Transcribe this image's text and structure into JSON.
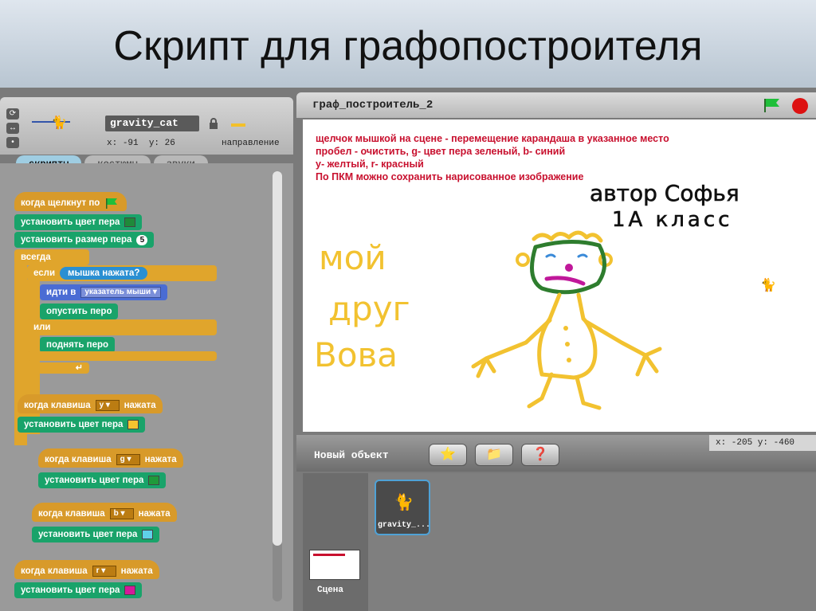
{
  "slide": {
    "title": "Скрипт для графопостроителя"
  },
  "sprite": {
    "name": "gravity_cat",
    "x_label": "x:",
    "x_value": "-91",
    "y_label": "y:",
    "y_value": "26",
    "direction_label": "направление"
  },
  "tabs": [
    {
      "label": "скрипты",
      "active": true
    },
    {
      "label": "костюмы",
      "active": false
    },
    {
      "label": "звуки",
      "active": false
    }
  ],
  "scripts": {
    "s1_hat": "когда щелкнут по",
    "s1_color": "установить цвет пера",
    "s1_color_value": "#1f8a3a",
    "s1_size": "установить размер пера",
    "s1_size_value": "5",
    "s1_forever": "всегда",
    "s1_if": "если",
    "s1_mouse_down": "мышка нажата?",
    "s1_goto": "идти в",
    "s1_goto_target": "указатель мыши",
    "s1_pen_down": "опустить перо",
    "s1_else": "или",
    "s1_pen_up": "поднять перо",
    "s1_end_arrow": "↵",
    "key_hat_prefix": "когда клавиша",
    "key_hat_suffix": "нажата",
    "set_color": "установить цвет пера",
    "keys": [
      {
        "key": "y",
        "color": "#f4c430"
      },
      {
        "key": "g",
        "color": "#1f9a3a"
      },
      {
        "key": "b",
        "color": "#5fd0e8"
      },
      {
        "key": "r",
        "color": "#d41a9a"
      }
    ]
  },
  "stage": {
    "title": "граф_построитель_2",
    "instructions": [
      "щелчок мышкой на сцене - перемещение карандаша в указанное место",
      "пробел - очистить, g- цвет пера зеленый, b- синий",
      "y- желтый, r- красный",
      "По ПКМ можно сохранить нарисованное изображение"
    ],
    "drawing_text": {
      "author": "автор Софья",
      "class_label": "1А класс",
      "line1": "мой",
      "line2": "друг",
      "line3": "Вова"
    },
    "colors": {
      "drawing_yellow": "#f2c230",
      "face_green": "#2e7d2e",
      "mouth_magenta": "#c0189a",
      "eyes_blue": "#3a8ad8"
    }
  },
  "bottom": {
    "coords": "x: -205  y: -460",
    "new_object_label": "Новый объект",
    "stage_label": "Сцена",
    "sprite_tile_label": "gravity_..."
  },
  "colors": {
    "hat": "#d89a2a",
    "pen": "#19a36a",
    "control": "#e0a52c",
    "motion": "#4a6cd4",
    "sensing": "#2a8fd2",
    "stop": "#dd1111"
  },
  "icons": {
    "green_flag": "green-flag-icon",
    "stop": "stop-icon",
    "lock": "lock-icon",
    "paint": "paint-new-sprite-icon",
    "folder": "choose-sprite-icon",
    "random": "random-sprite-icon"
  }
}
